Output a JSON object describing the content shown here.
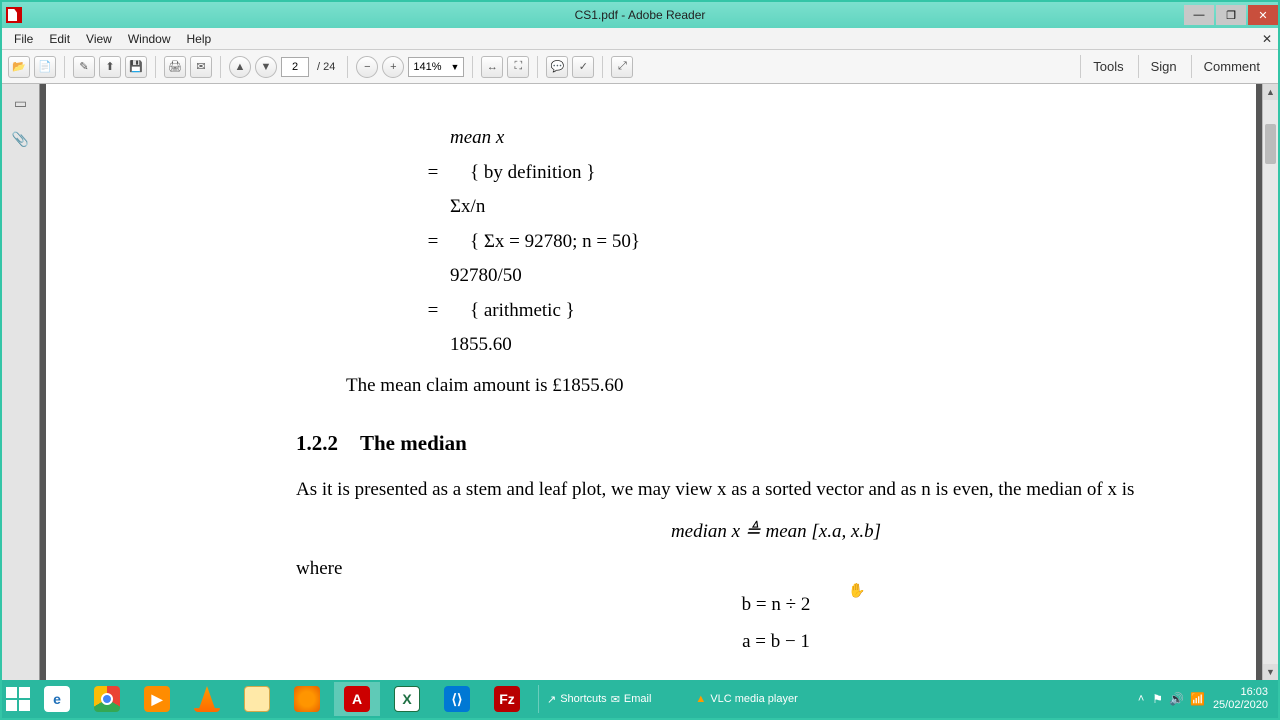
{
  "window": {
    "title": "CS1.pdf - Adobe Reader",
    "minimize": "—",
    "maximize": "❐",
    "close": "✕"
  },
  "menu": {
    "file": "File",
    "edit": "Edit",
    "view": "View",
    "window": "Window",
    "help": "Help",
    "close_menu": "✕"
  },
  "toolbar": {
    "page_current": "2",
    "page_total": "/ 24",
    "zoom": "141%",
    "tabs": {
      "tools": "Tools",
      "sign": "Sign",
      "comment": "Comment"
    }
  },
  "doc": {
    "l1": "mean x",
    "l2_eq": "=",
    "l2": "{   by definition   }",
    "l3": "Σx/n",
    "l4_eq": "=",
    "l4": "{   Σx = 92780; n = 50}",
    "l5": "92780/50",
    "l6_eq": "=",
    "l6": "{   arithmetic   }",
    "l7": "1855.60",
    "result": "The mean claim amount is £1855.60",
    "sec_num": "1.2.2",
    "sec_title": "The median",
    "para": "As it is presented as a stem and leaf plot, we may view x as a sorted vector and as n is even, the median of x is",
    "eq_median": "median x  ≜  mean [x.a, x.b]",
    "where": "where",
    "eq_b": "b    =    n ÷ 2",
    "eq_a": "a = b − 1"
  },
  "taskbar": {
    "shortcuts": "Shortcuts",
    "email": "Email",
    "vlc": "VLC media player",
    "time": "16:03",
    "date": "25/02/2020"
  }
}
